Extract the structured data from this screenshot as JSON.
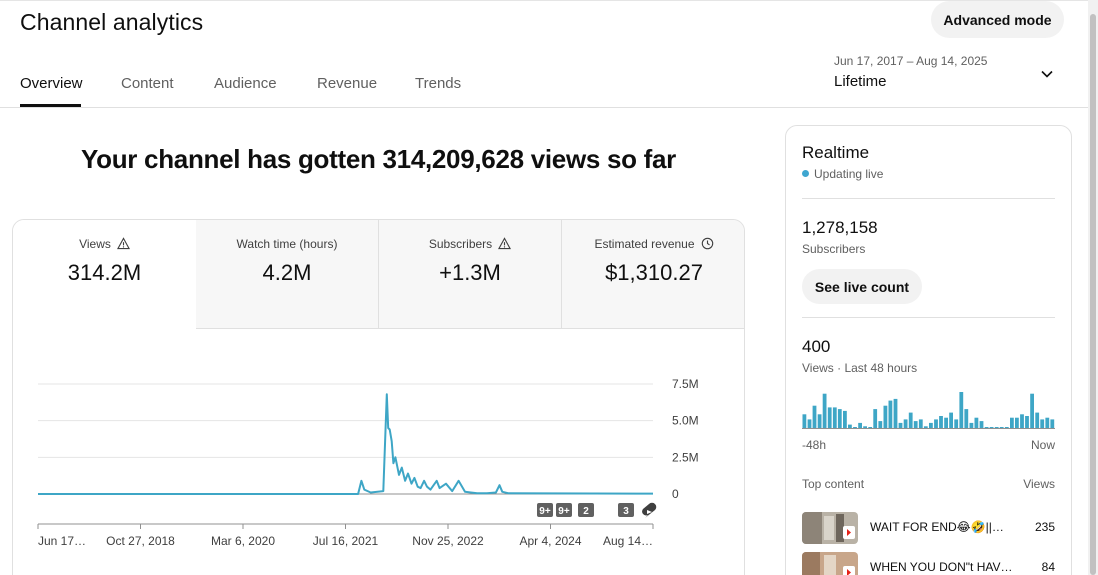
{
  "header": {
    "title": "Channel analytics",
    "advanced_mode": "Advanced mode"
  },
  "tabs": [
    {
      "label": "Overview",
      "active": true
    },
    {
      "label": "Content"
    },
    {
      "label": "Audience"
    },
    {
      "label": "Revenue"
    },
    {
      "label": "Trends"
    }
  ],
  "date_picker": {
    "range": "Jun 17, 2017 – Aug 14, 2025",
    "label": "Lifetime",
    "icon": "chevron-down-icon"
  },
  "headline": "Your channel has gotten 314,209,628 views so far",
  "metrics": [
    {
      "label": "Views",
      "value": "314.2M",
      "icon": "warning-icon",
      "active": true
    },
    {
      "label": "Watch time (hours)",
      "value": "4.2M"
    },
    {
      "label": "Subscribers",
      "value": "+1.3M",
      "icon": "warning-icon"
    },
    {
      "label": "Estimated revenue",
      "value": "$1,310.27",
      "icon": "clock-icon"
    }
  ],
  "chart_data": {
    "type": "line",
    "y_ticks": [
      "7.5M",
      "5.0M",
      "2.5M",
      "0"
    ],
    "ylim": [
      0,
      7500000
    ],
    "x_ticks": [
      "Jun 17…",
      "Oct 27, 2018",
      "Mar 6, 2020",
      "Jul 16, 2021",
      "Nov 25, 2022",
      "Apr 4, 2024",
      "Aug 14…"
    ],
    "x_domain": [
      "2017-06-17",
      "2025-08-14"
    ],
    "series": [
      {
        "color": "#3ea6c6",
        "points": [
          [
            "2017-06-17",
            0
          ],
          [
            "2021-07-15",
            0
          ],
          [
            "2021-09-15",
            0
          ],
          [
            "2021-10-01",
            900000
          ],
          [
            "2021-10-15",
            300000
          ],
          [
            "2021-11-15",
            100000
          ],
          [
            "2022-01-15",
            200000
          ],
          [
            "2022-02-01",
            6800000
          ],
          [
            "2022-02-08",
            4500000
          ],
          [
            "2022-02-15",
            4400000
          ],
          [
            "2022-02-25",
            3600000
          ],
          [
            "2022-03-05",
            2100000
          ],
          [
            "2022-03-15",
            2500000
          ],
          [
            "2022-04-01",
            1300000
          ],
          [
            "2022-04-15",
            1800000
          ],
          [
            "2022-05-01",
            900000
          ],
          [
            "2022-05-15",
            1400000
          ],
          [
            "2022-06-01",
            700000
          ],
          [
            "2022-06-15",
            1100000
          ],
          [
            "2022-07-01",
            500000
          ],
          [
            "2022-07-15",
            400000
          ],
          [
            "2022-08-01",
            900000
          ],
          [
            "2022-08-15",
            500000
          ],
          [
            "2022-09-01",
            300000
          ],
          [
            "2022-10-01",
            900000
          ],
          [
            "2022-10-15",
            400000
          ],
          [
            "2022-11-15",
            700000
          ],
          [
            "2022-12-15",
            200000
          ],
          [
            "2023-01-15",
            900000
          ],
          [
            "2023-02-15",
            150000
          ],
          [
            "2023-03-15",
            100000
          ],
          [
            "2023-04-15",
            50000
          ],
          [
            "2023-06-01",
            50000
          ],
          [
            "2023-07-15",
            100000
          ],
          [
            "2023-08-01",
            600000
          ],
          [
            "2023-08-15",
            150000
          ],
          [
            "2023-09-15",
            50000
          ],
          [
            "2025-08-14",
            30000
          ]
        ]
      }
    ],
    "markers": [
      "9+",
      "9+",
      "2",
      "3"
    ],
    "grid": true
  },
  "realtime": {
    "title": "Realtime",
    "status": "Updating live",
    "subscribers_count": "1,278,158",
    "subscribers_label": "Subscribers",
    "live_count_button": "See live count",
    "views_count": "400",
    "views_label": "Views · Last 48 hours",
    "sparkline": [
      8,
      5,
      13,
      8,
      20,
      12,
      12,
      11,
      10,
      2,
      0,
      3,
      1,
      0,
      11,
      4,
      13,
      16,
      17,
      3,
      5,
      9,
      4,
      5,
      1,
      3,
      5,
      7,
      6,
      9,
      5,
      21,
      11,
      3,
      6,
      4,
      0,
      0,
      0,
      0,
      0,
      6,
      6,
      8,
      7,
      20,
      9,
      5,
      6,
      5
    ],
    "spark_start": "-48h",
    "spark_end": "Now",
    "top_content_label": "Top content",
    "top_content_views_label": "Views",
    "top_content": [
      {
        "title": "WAIT FOR END😂🤣||…",
        "views": "235"
      },
      {
        "title": "WHEN YOU DON\"t HAV…",
        "views": "84"
      }
    ]
  }
}
